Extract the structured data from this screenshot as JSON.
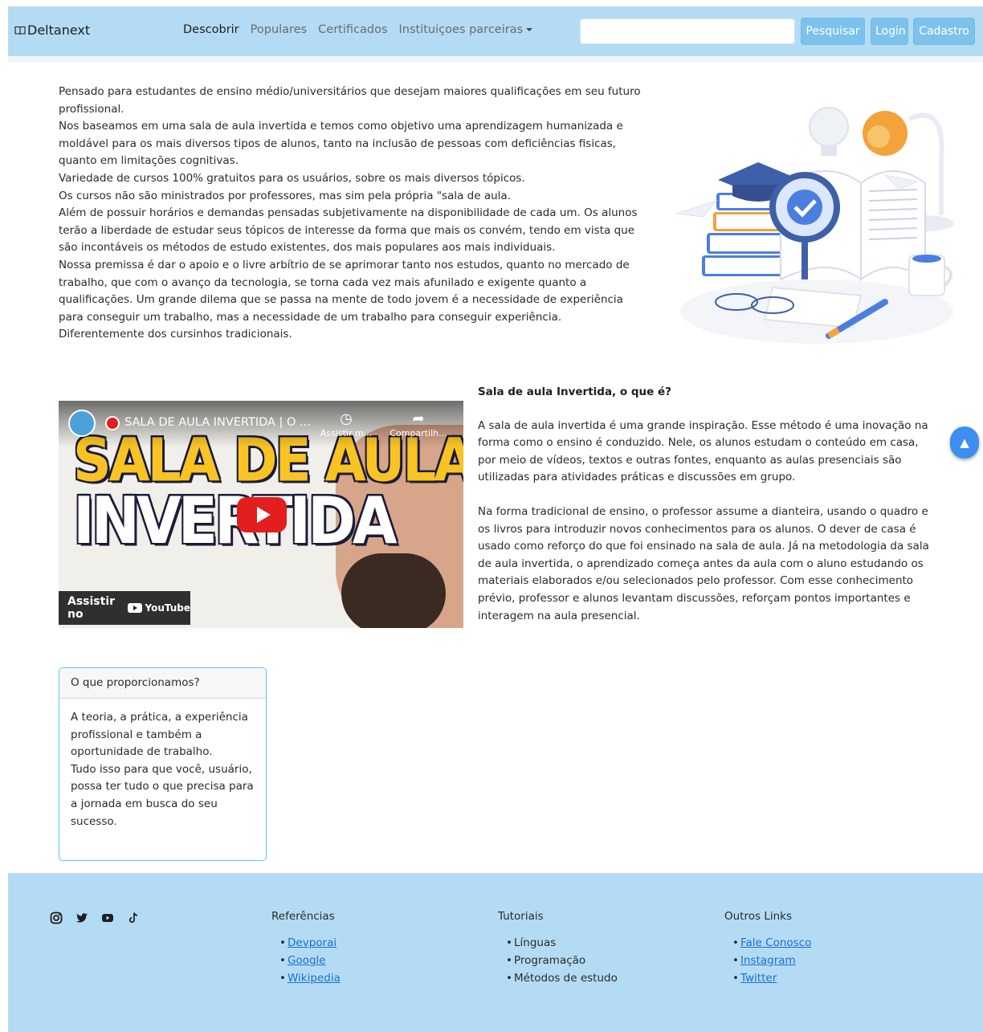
{
  "navbar": {
    "brand": "Deltanext",
    "links": [
      "Descobrir",
      "Populares",
      "Certificados",
      "Instituiçoes parceiras"
    ],
    "search_placeholder": "",
    "search_button": "Pesquisar",
    "login_button": "Login",
    "signup_button": "Cadastro"
  },
  "intro": {
    "paragraphs": [
      "Pensado para estudantes de ensino médio/universitários que desejam maiores qualificações em seu futuro profissional.",
      "Nos baseamos em uma sala de aula invertida e temos como objetivo uma aprendizagem humanizada e moldável para os mais diversos tipos de alunos, tanto na inclusão de pessoas com deficiências fisicas, quanto em limitações cognitivas.",
      "Variedade de cursos 100% gratuitos para os usuários, sobre os mais diversos tópicos.",
      "Os cursos não são ministrados por professores, mas sim pela própria \"sala de aula.",
      "Além de possuir horários e demandas pensadas subjetivamente na disponibilidade de cada um. Os alunos terão a liberdade de estudar seus tópicos de interesse da forma que mais os convém, tendo em vista que são incontáveis os métodos de estudo existentes, dos mais populares aos mais individuais.",
      "Nossa premissa é dar o apoio e o livre arbítrio de se aprimorar tanto nos estudos, quanto no mercado de trabalho, que com o avanço da tecnologia, se torna cada vez mais afunilado e exigente quanto a qualificações. Um grande dilema que se passa na mente de todo jovem é a necessidade de experiência para conseguir um trabalho, mas a necessidade de um trabalho para conseguir experiência. Diferentemente dos cursinhos tradicionais."
    ]
  },
  "video": {
    "title": "SALA DE AULA INVERTIDA | O ...",
    "watch_later": "Assistir m...",
    "share": "Compartilh...",
    "thumb_line1": "SALA DE AULA",
    "thumb_line2": "INVERTIDA",
    "watch_on": "Assistir no",
    "youtube": "YouTube"
  },
  "sala": {
    "heading": "Sala de aula Invertida, o que é?",
    "p1": "A sala de aula invertida é uma grande inspiração. Esse método é uma inovação na forma como o ensino é conduzido. Nele, os alunos estudam o conteúdo em casa, por meio de vídeos, textos e outras fontes, enquanto as aulas presenciais são utilizadas para atividades práticas e discussões em grupo.",
    "p2": "Na forma tradicional de ensino, o professor assume a dianteira, usando o quadro e os livros para introduzir novos conhecimentos para os alunos. O dever de casa é usado como reforço do que foi ensinado na sala de aula. Já na metodologia da sala de aula invertida, o aprendizado começa antes da aula com o aluno estudando os materiais elaborados e/ou selecionados pelo professor. Com esse conhecimento prévio, professor e alunos levantam discussões, reforçam pontos importantes e interagem na aula presencial."
  },
  "scroll_top": "▲",
  "card": {
    "header": "O que proporcionamos?",
    "body_1": "A teoria, a prática, a experiência profissional e também a oportunidade de trabalho.",
    "body_2": "Tudo isso para que você, usuário, possa ter tudo o que precisa para a jornada em busca do seu sucesso."
  },
  "footer": {
    "social_icons": [
      "instagram-icon",
      "twitter-icon",
      "youtube-icon",
      "tiktok-icon"
    ],
    "references": {
      "title": "Referências",
      "items": [
        "Devporai",
        "Google",
        "Wikipedia"
      ]
    },
    "tutorials": {
      "title": "Tutoriais",
      "items": [
        "Línguas",
        "Programação",
        "Métodos de estudo"
      ]
    },
    "other_links": {
      "title": "Outros Links",
      "items": [
        "Fale Conosco",
        "Instagram",
        "Twitter"
      ]
    }
  },
  "colors": {
    "navbar_bg": "#b3dcf4",
    "button_bg": "#7cc2ec",
    "footer_bg": "#b3dcf4",
    "link": "#1a6fd1",
    "card_border": "#5ac8e8",
    "scroll_top_bg": "#3c8ef0"
  }
}
